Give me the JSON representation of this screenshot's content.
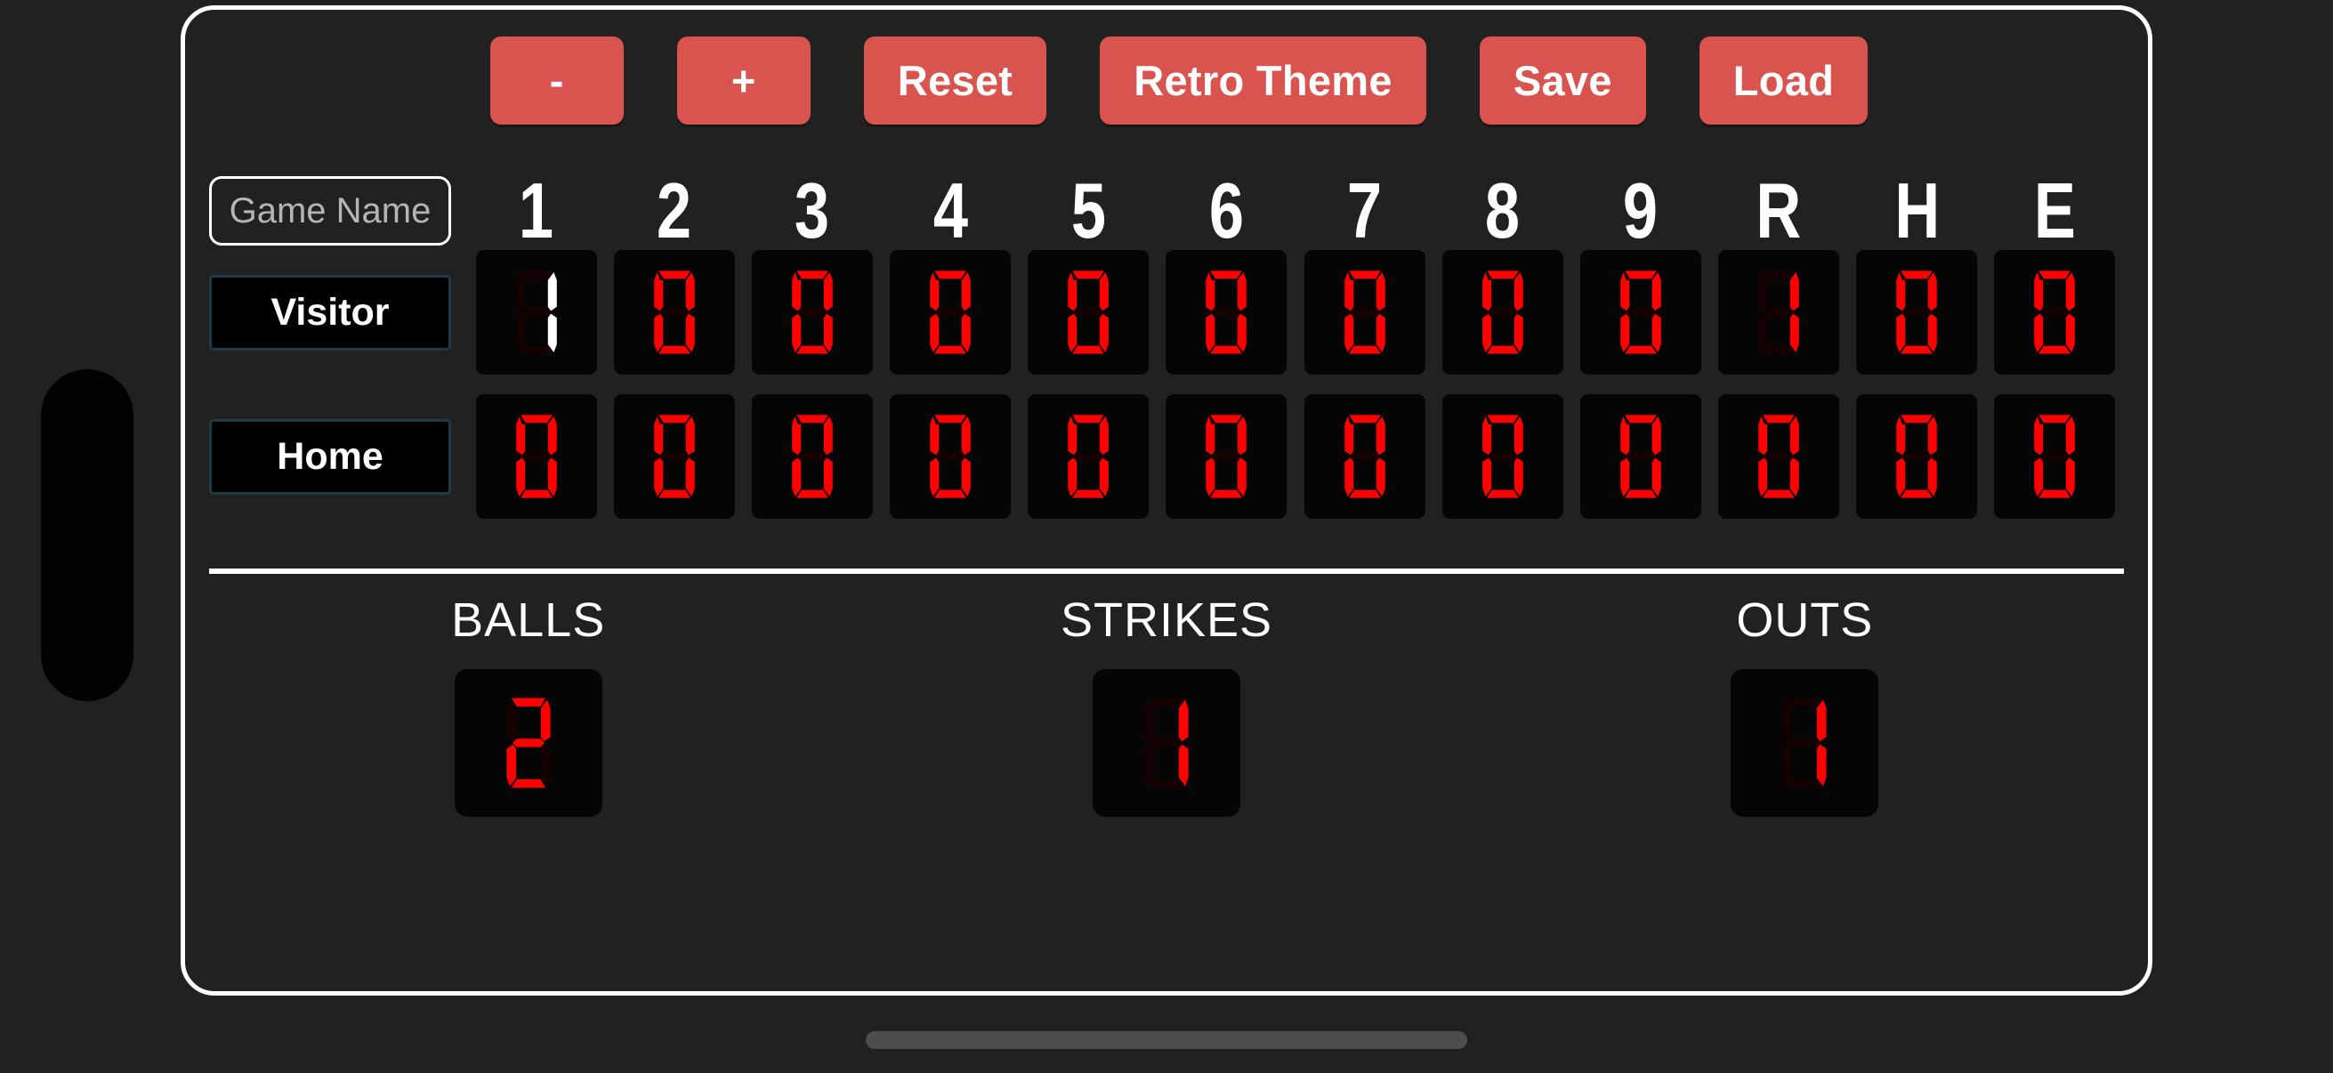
{
  "theme": {
    "app_background": "#212121",
    "panel_border": "#ffffff",
    "button_color": "#d9534f",
    "button_text": "#ffffff",
    "led_on": "#ff0000",
    "led_active": "#ffffff",
    "led_off": "#140000",
    "led_background": "#050505",
    "team_box_border": "#1d3b46",
    "divider_color": "#ffffff",
    "home_indicator": "#4d4d4d"
  },
  "toolbar": {
    "buttons": [
      {
        "label": "-",
        "name": "decrement-button"
      },
      {
        "label": "+",
        "name": "increment-button"
      },
      {
        "label": "Reset",
        "name": "reset-button"
      },
      {
        "label": "Retro Theme",
        "name": "retro-theme-button"
      },
      {
        "label": "Save",
        "name": "save-button"
      },
      {
        "label": "Load",
        "name": "load-button"
      }
    ]
  },
  "scoreboard": {
    "game_name": {
      "value": "",
      "placeholder": "Game Name"
    },
    "columns": [
      "1",
      "2",
      "3",
      "4",
      "5",
      "6",
      "7",
      "8",
      "9",
      "R",
      "H",
      "E"
    ],
    "rows": [
      {
        "team": "Visitor",
        "name": "visitor",
        "values": [
          "1",
          "0",
          "0",
          "0",
          "0",
          "0",
          "0",
          "0",
          "0",
          "1",
          "0",
          "0"
        ],
        "active_index": 0
      },
      {
        "team": "Home",
        "name": "home",
        "values": [
          "0",
          "0",
          "0",
          "0",
          "0",
          "0",
          "0",
          "0",
          "0",
          "0",
          "0",
          "0"
        ],
        "active_index": -1
      }
    ]
  },
  "count": [
    {
      "label": "BALLS",
      "value": "2",
      "name": "balls"
    },
    {
      "label": "STRIKES",
      "value": "1",
      "name": "strikes"
    },
    {
      "label": "OUTS",
      "value": "1",
      "name": "outs"
    }
  ]
}
